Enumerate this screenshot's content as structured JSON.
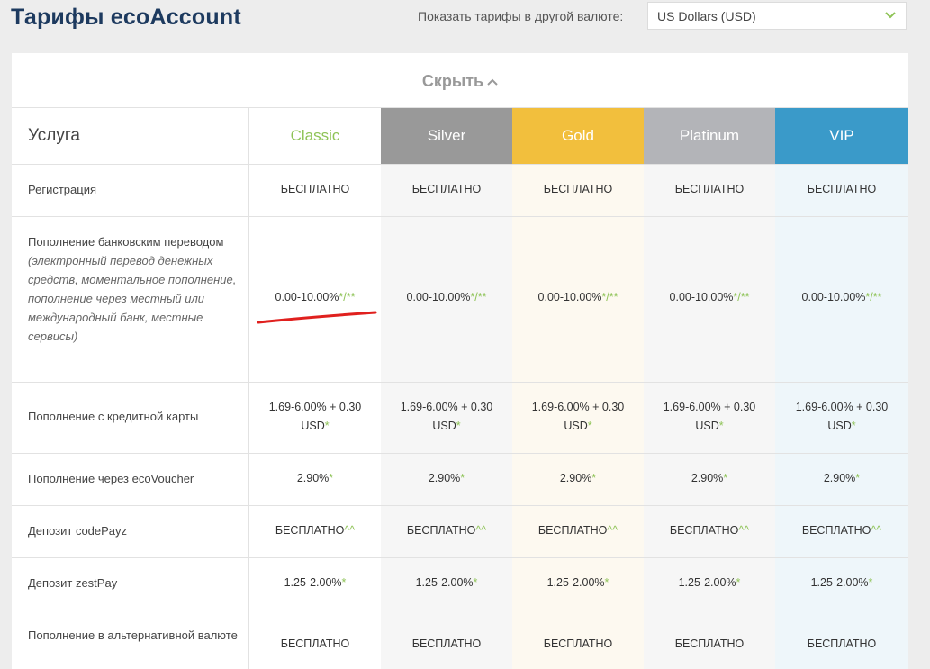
{
  "header": {
    "title": "Тарифы ecoAccount",
    "currency_label": "Показать тарифы в другой валюте:",
    "currency_value": "US Dollars (USD)"
  },
  "table": {
    "hide_label": "Скрыть",
    "service_header": "Услуга",
    "tiers": [
      {
        "name": "Classic",
        "color": "#8ec356"
      },
      {
        "name": "Silver",
        "color": "#999999"
      },
      {
        "name": "Gold",
        "color": "#f2bf3d"
      },
      {
        "name": "Platinum",
        "color": "#b3b4b8"
      },
      {
        "name": "VIP",
        "color": "#3a9ac9"
      }
    ],
    "rows": [
      {
        "label": "Регистрация",
        "values": [
          "БЕСПЛАТНО",
          "БЕСПЛАТНО",
          "БЕСПЛАТНО",
          "БЕСПЛАТНО",
          "БЕСПЛАТНО"
        ],
        "mark": ""
      },
      {
        "label": "Пополнение банковским переводом",
        "note": "(электронный перевод денежных средств, моментальное пополнение, пополнение через местный или международный банк, местные сервисы)",
        "values": [
          "0.00-10.00%",
          "0.00-10.00%",
          "0.00-10.00%",
          "0.00-10.00%",
          "0.00-10.00%"
        ],
        "mark": "*/**"
      },
      {
        "label": "Пополнение с кредитной карты",
        "values_line1": [
          "1.69-6.00% + 0.30",
          "1.69-6.00% + 0.30",
          "1.69-6.00% + 0.30",
          "1.69-6.00% + 0.30",
          "1.69-6.00% + 0.30"
        ],
        "values": [
          "USD",
          "USD",
          "USD",
          "USD",
          "USD"
        ],
        "mark": "*"
      },
      {
        "label": "Пополнение через ecoVoucher",
        "values": [
          "2.90%",
          "2.90%",
          "2.90%",
          "2.90%",
          "2.90%"
        ],
        "mark": "*"
      },
      {
        "label": "Депозит codePayz",
        "values": [
          "БЕСПЛАТНО",
          "БЕСПЛАТНО",
          "БЕСПЛАТНО",
          "БЕСПЛАТНО",
          "БЕСПЛАТНО"
        ],
        "mark": "^^"
      },
      {
        "label": "Депозит zestPay",
        "values": [
          "1.25-2.00%",
          "1.25-2.00%",
          "1.25-2.00%",
          "1.25-2.00%",
          "1.25-2.00%"
        ],
        "mark": "*"
      },
      {
        "label": "Пополнение в альтернативной валюте",
        "values": [
          "БЕСПЛАТНО",
          "БЕСПЛАТНО",
          "БЕСПЛАТНО",
          "БЕСПЛАТНО",
          "БЕСПЛАТНО"
        ],
        "mark": ""
      }
    ]
  },
  "colors": {
    "title": "#1d3a5f",
    "accent_green": "#8ec356",
    "annotation_red": "#e0201e"
  }
}
